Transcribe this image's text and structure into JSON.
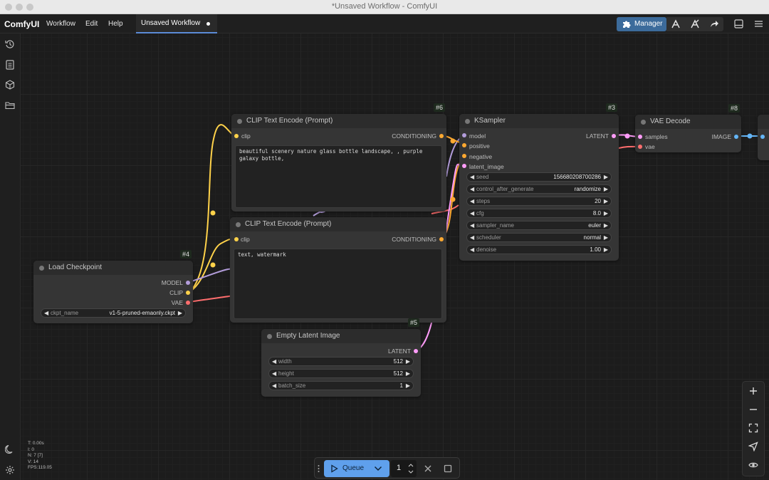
{
  "window": {
    "title": "*Unsaved Workflow - ComfyUI"
  },
  "menubar": {
    "brand": "ComfyUI",
    "items": [
      "Workflow",
      "Edit",
      "Help"
    ],
    "active_tab": "Unsaved Workflow",
    "manager_label": "Manager"
  },
  "sidebar": {
    "icons": [
      "history-icon",
      "queue-list-icon",
      "model-library-icon",
      "folder-icon",
      "theme-toggle-icon",
      "settings-icon"
    ]
  },
  "nodes": {
    "clip_pos": {
      "id": "#6",
      "title": "CLIP Text Encode (Prompt)",
      "input": "clip",
      "output": "CONDITIONING",
      "text": "beautiful scenery nature glass bottle landscape, , purple galaxy bottle,"
    },
    "clip_neg": {
      "title": "CLIP Text Encode (Prompt)",
      "input": "clip",
      "output": "CONDITIONING",
      "text": "text, watermark"
    },
    "ksampler": {
      "id": "#3",
      "title": "KSampler",
      "inputs": [
        "model",
        "positive",
        "negative",
        "latent_image"
      ],
      "output": "LATENT",
      "widgets": [
        {
          "name": "seed",
          "value": "156680208700286"
        },
        {
          "name": "control_after_generate",
          "value": "randomize"
        },
        {
          "name": "steps",
          "value": "20"
        },
        {
          "name": "cfg",
          "value": "8.0"
        },
        {
          "name": "sampler_name",
          "value": "euler"
        },
        {
          "name": "scheduler",
          "value": "normal"
        },
        {
          "name": "denoise",
          "value": "1.00"
        }
      ]
    },
    "vae_decode": {
      "id": "#8",
      "title": "VAE Decode",
      "inputs": [
        "samples",
        "vae"
      ],
      "output": "IMAGE"
    },
    "checkpoint": {
      "id": "#4",
      "title": "Load Checkpoint",
      "outputs": [
        "MODEL",
        "CLIP",
        "VAE"
      ],
      "widget": {
        "name": "ckpt_name",
        "value": "v1-5-pruned-emaonly.ckpt"
      }
    },
    "latent": {
      "id": "#5",
      "title": "Empty Latent Image",
      "output": "LATENT",
      "widgets": [
        {
          "name": "width",
          "value": "512"
        },
        {
          "name": "height",
          "value": "512"
        },
        {
          "name": "batch_size",
          "value": "1"
        }
      ]
    }
  },
  "stats": [
    "T: 0.00s",
    "I: 0",
    "N: 7 [7]",
    "V: 14",
    "FPS:119.05"
  ],
  "queue": {
    "label": "Queue",
    "count": "1"
  },
  "colors": {
    "clip_wire": "#ffd24a",
    "model_wire": "#b39ddb",
    "vae_wire": "#ff6e6e",
    "latent_wire": "#ff9cf9",
    "conditioning_wire": "#ffa931",
    "image_wire": "#64b5f6",
    "accent": "#5fa0ec",
    "manager": "#3c6b9b"
  }
}
